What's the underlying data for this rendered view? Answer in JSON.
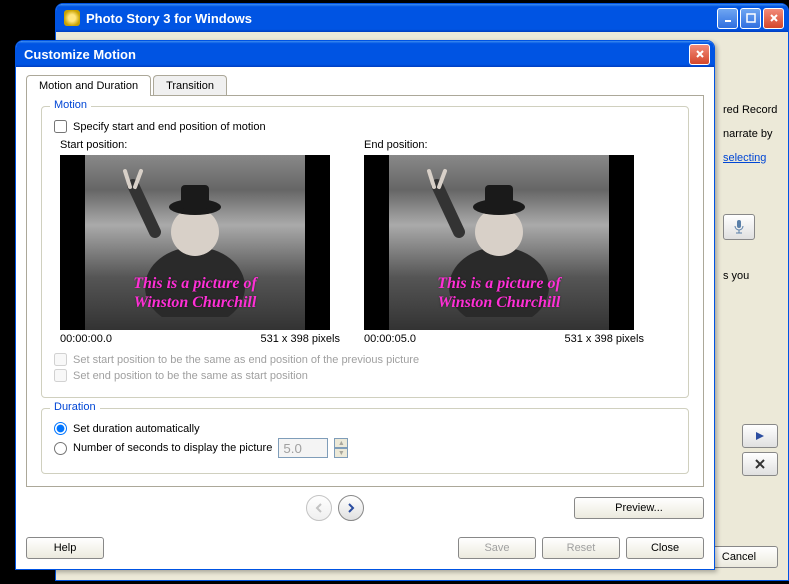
{
  "parent": {
    "title": "Photo Story 3 for Windows",
    "right_text1": "red Record",
    "right_text2": "narrate by",
    "link": "selecting",
    "right_text3": "s you",
    "cancel": "Cancel"
  },
  "modal": {
    "title": "Customize Motion",
    "tabs": {
      "motion": "Motion and Duration",
      "transition": "Transition"
    },
    "motion": {
      "group": "Motion",
      "specify": "Specify start and end position of motion",
      "start_label": "Start position:",
      "end_label": "End position:",
      "caption_line1": "This is a picture of",
      "caption_line2": "Winston Churchill",
      "start_time": "00:00:00.0",
      "end_time": "00:00:05.0",
      "dims": "531 x 398 pixels",
      "cb_start_same": "Set start position to be the same as end position of the previous picture",
      "cb_end_same": "Set end position to be the same as start position"
    },
    "duration": {
      "group": "Duration",
      "auto": "Set duration automatically",
      "seconds_label": "Number of seconds to display the picture",
      "seconds_value": "5.0"
    },
    "buttons": {
      "preview": "Preview...",
      "help": "Help",
      "save": "Save",
      "reset": "Reset",
      "close": "Close"
    }
  }
}
